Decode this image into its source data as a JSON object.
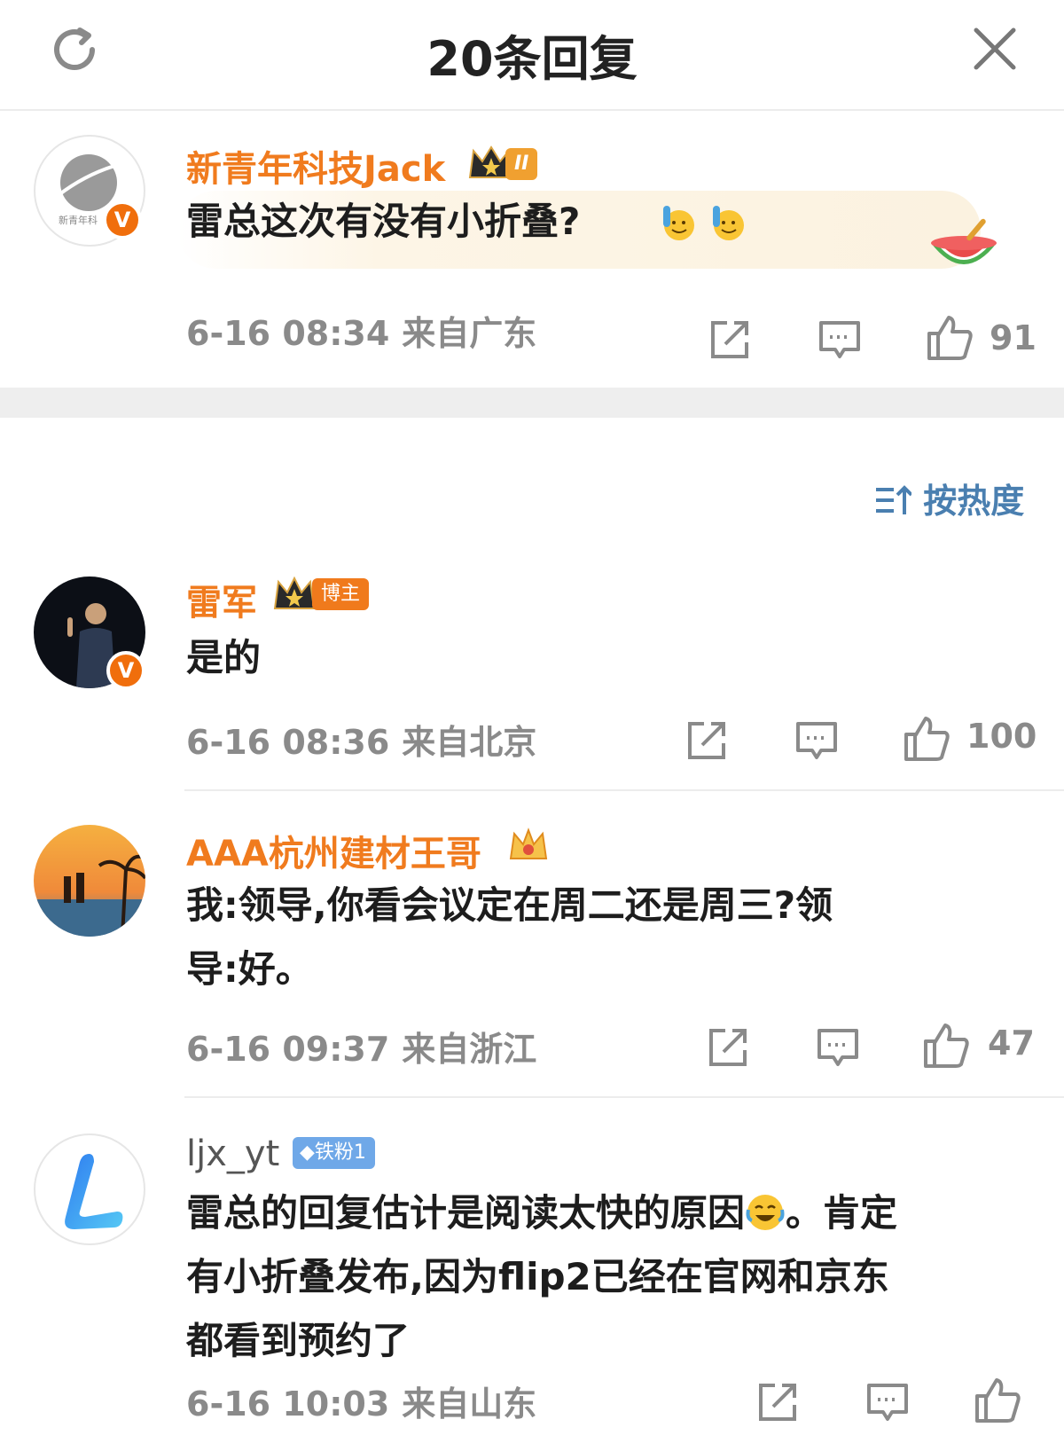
{
  "header": {
    "title": "20条回复",
    "refresh_icon": "refresh-icon",
    "close_icon": "close-icon"
  },
  "root_comment": {
    "username": "新青年科技Jack",
    "avatar_label": "新青年科",
    "level_badge": "II",
    "text": "雷总这次有没有小折叠?",
    "time": "6-16 08:34",
    "location": "来自广东",
    "likes": "91"
  },
  "sort": {
    "label": "按热度"
  },
  "replies": [
    {
      "username": "雷军",
      "badge": "博主",
      "text": "是的",
      "time": "6-16 08:36",
      "location": "来自北京",
      "likes": "100"
    },
    {
      "username": "AAA杭州建材王哥",
      "text": "我:领导,你看会议定在周二还是周三?领导:好。",
      "text_line1": "我:领导,你看会议定在周二还是周三?领",
      "text_line2": "导:好。",
      "time": "6-16 09:37",
      "location": "来自浙江",
      "likes": "47"
    },
    {
      "username": "ljx_yt",
      "badge": "铁粉1",
      "text_line1": "雷总的回复估计是阅读太快的原因",
      "text_line1b": "。肯定",
      "text_line2": "有小折叠发布,因为flip2已经在官网和京东",
      "text_line3": "都看到预约了",
      "time": "6-16 10:03",
      "location": "来自山东"
    }
  ],
  "colors": {
    "accent_orange": "#f07b1e",
    "sort_blue": "#4a7fb0",
    "meta_gray": "#8a8a8a"
  }
}
